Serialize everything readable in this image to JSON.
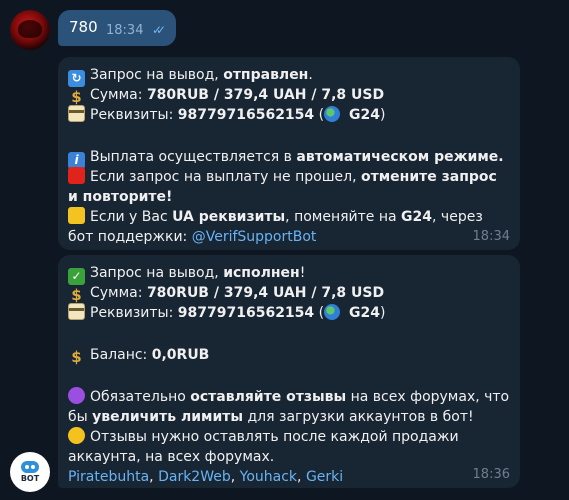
{
  "outgoing": {
    "text": "780",
    "time": "18:34",
    "ticks": "✓✓"
  },
  "bot_avatar": {
    "label": "BOT"
  },
  "message1": {
    "l1_text": "Запрос на вывод, ",
    "l1_bold": "отправлен",
    "l1_end": ".",
    "l2_text": "Сумма: ",
    "l2_bold": "780RUB  / 379,4 UAH / 7,8 USD",
    "l3_text": "Реквизиты: ",
    "l3_bold": "98779716562154",
    "l3_open": " (",
    "l3_bold2": " G24",
    "l3_close": ")",
    "l4_text": "Выплата осуществляется в ",
    "l4_bold": "автоматическом режиме.",
    "l5_text": "Если запрос на выплату не прошел, ",
    "l5_bold": "отмените запрос и повторите!",
    "l6_text1": "Если у Вас ",
    "l6_bold1": "UA реквизиты",
    "l6_text2": ", поменяйте на ",
    "l6_bold2": "G24",
    "l6_text3": ", через бот поддержки: ",
    "l6_link": "@VerifSupportBot",
    "time": "18:34"
  },
  "message2": {
    "l1_text": "Запрос на вывод, ",
    "l1_bold": "исполнен",
    "l1_end": "!",
    "l2_text": "Сумма: ",
    "l2_bold": "780RUB  / 379,4 UAH / 7,8 USD",
    "l3_text": "Реквизиты: ",
    "l3_bold": "98779716562154",
    "l3_open": " (",
    "l3_bold2": " G24",
    "l3_close": ")",
    "balance_text": "Баланс: ",
    "balance_bold": "0,0RUB",
    "l5_text1": "Обязательно ",
    "l5_bold1": "оставляйте отзывы",
    "l5_text2": " на всех форумах, что бы ",
    "l5_bold2": "увеличить лимиты",
    "l5_text3": " для загрузки аккаунтов в бот!",
    "l6_text": "Отзывы нужно оставлять после каждой продажи аккаунта, на всех форумах.",
    "links": [
      "Piratebuhta",
      "Dark2Web",
      "Youhack",
      "Gerki"
    ],
    "sep": ", ",
    "time": "18:36"
  }
}
